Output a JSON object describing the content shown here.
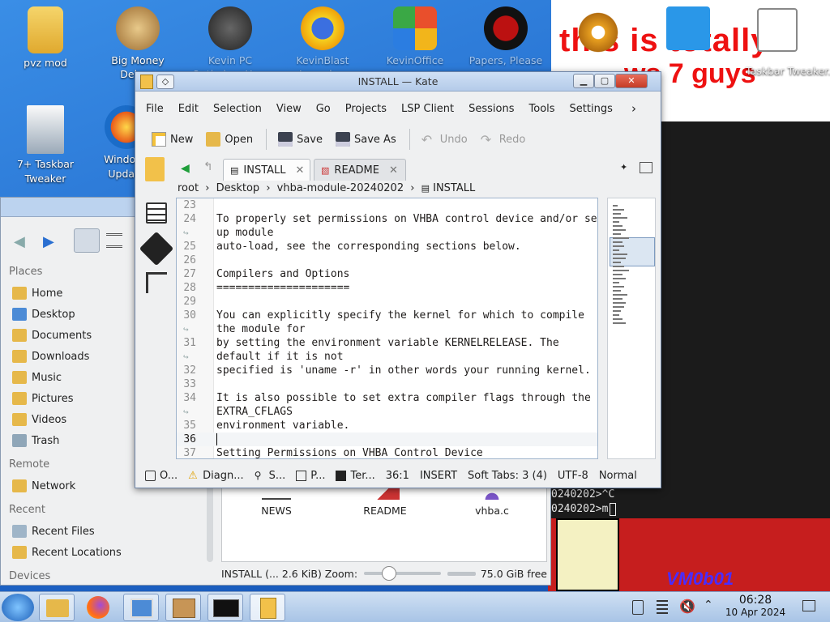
{
  "desktop_icons": [
    {
      "label": "pvz mod"
    },
    {
      "label": "Big Money Deluxe"
    },
    {
      "label": "Kevin PC Optimizer Ho..."
    },
    {
      "label": "KevinBlast Launcher"
    },
    {
      "label": "KevinOffice"
    },
    {
      "label": "Papers, Please"
    },
    {
      "label": "7+ Taskbar Tweaker"
    },
    {
      "label": "Windows Update"
    },
    {
      "label": "Taskbar Tweaker.lnk"
    }
  ],
  "poster": {
    "line1": "this is totally",
    "line2": "ws 7 guys"
  },
  "terminal": {
    "line1": "0240202>^C",
    "line2": "0240202>m"
  },
  "redpanel": {
    "brand": "VM0b01"
  },
  "dolphin": {
    "places_heading": "Places",
    "places": [
      "Home",
      "Desktop",
      "Documents",
      "Downloads",
      "Music",
      "Pictures",
      "Videos",
      "Trash"
    ],
    "remote_heading": "Remote",
    "remote": [
      "Network"
    ],
    "recent_heading": "Recent",
    "recent": [
      "Recent Files",
      "Recent Locations"
    ],
    "devices_heading": "Devices",
    "files": [
      "NEWS",
      "README",
      "vhba.c"
    ],
    "status_text": "INSTALL (... 2.6 KiB) Zoom:",
    "free_space": "75.0 GiB free"
  },
  "kate": {
    "title": "INSTALL — Kate",
    "menu": [
      "File",
      "Edit",
      "Selection",
      "View",
      "Go",
      "Projects",
      "LSP Client",
      "Sessions",
      "Tools",
      "Settings"
    ],
    "toolbar": {
      "new": "New",
      "open": "Open",
      "save": "Save",
      "save_as": "Save As",
      "undo": "Undo",
      "redo": "Redo"
    },
    "tabs": [
      {
        "label": "INSTALL"
      },
      {
        "label": "README"
      }
    ],
    "breadcrumb": {
      "root": "root",
      "desktop": "Desktop",
      "folder": "vhba-module-20240202",
      "file": "INSTALL"
    },
    "lines": [
      {
        "n": "23",
        "t": ""
      },
      {
        "n": "24",
        "t": "To properly set permissions on VHBA control device and/or set"
      },
      {
        "n": "",
        "t": "up module"
      },
      {
        "n": "25",
        "t": "auto-load, see the corresponding sections below."
      },
      {
        "n": "26",
        "t": ""
      },
      {
        "n": "27",
        "t": "Compilers and Options"
      },
      {
        "n": "28",
        "t": "====================="
      },
      {
        "n": "29",
        "t": ""
      },
      {
        "n": "30",
        "t": "You can explicitly specify the kernel for which to compile"
      },
      {
        "n": "",
        "t": "the module for"
      },
      {
        "n": "31",
        "t": "by setting the environment variable KERNELRELEASE. The"
      },
      {
        "n": "",
        "t": "default if it is not"
      },
      {
        "n": "32",
        "t": "specified is 'uname -r' in other words your running kernel."
      },
      {
        "n": "33",
        "t": ""
      },
      {
        "n": "34",
        "t": "It is also possible to set extra compiler flags through the"
      },
      {
        "n": "",
        "t": "EXTRA_CFLAGS"
      },
      {
        "n": "35",
        "t": "environment variable."
      },
      {
        "n": "36",
        "t": ""
      },
      {
        "n": "37",
        "t": "Setting Permissions on VHBA Control Device"
      }
    ],
    "status": {
      "output": "O...",
      "diagnostics": "Diagn...",
      "search": "S...",
      "projects": "P...",
      "terminal": "Ter...",
      "cursor": "36:1",
      "mode": "INSERT",
      "indent": "Soft Tabs: 3 (4)",
      "encoding": "UTF-8",
      "style": "Normal"
    }
  },
  "clock": {
    "time": "06:28",
    "date": "10 Apr 2024"
  }
}
